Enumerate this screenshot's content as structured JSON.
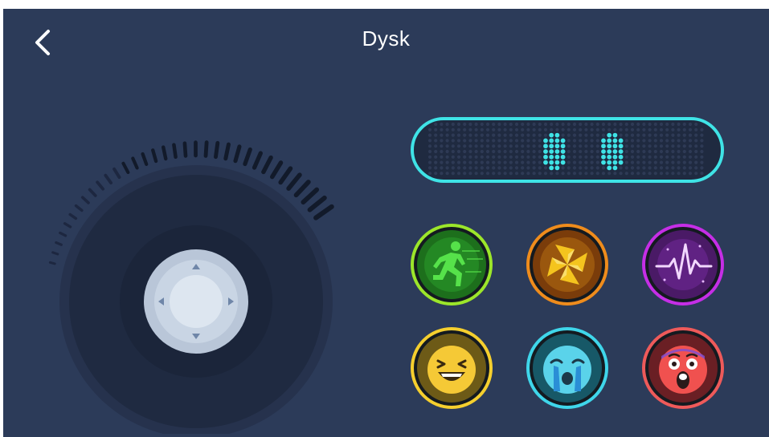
{
  "header": {
    "title": "Dysk",
    "back_icon": "chevron-left-icon"
  },
  "joystick": {
    "icons": [
      "arrow-up-icon",
      "arrow-down-icon",
      "arrow-left-icon",
      "arrow-right-icon"
    ]
  },
  "led_display": {
    "color": "#3fe3e6"
  },
  "action_buttons": [
    {
      "icon": "running-man-icon",
      "ring_color": "#9ce62a"
    },
    {
      "icon": "pinwheel-icon",
      "ring_color": "#ef8c1c"
    },
    {
      "icon": "sound-wave-icon",
      "ring_color": "#c52ee6"
    },
    {
      "icon": "laughing-face-icon",
      "ring_color": "#f5cf2e"
    },
    {
      "icon": "crying-face-icon",
      "ring_color": "#3fd6ea"
    },
    {
      "icon": "shocked-face-icon",
      "ring_color": "#ee5a5a"
    }
  ],
  "colors": {
    "background": "#2c3b59",
    "accent": "#3fe3e6"
  }
}
